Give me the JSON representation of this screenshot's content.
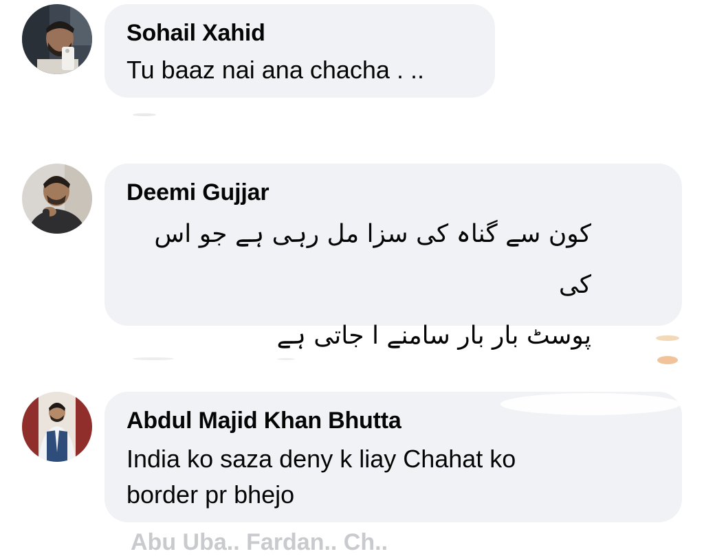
{
  "comments": [
    {
      "author": "Sohail Xahid",
      "text": "Tu baaz nai ana chacha . ..",
      "avatar": "avatar-man-selfie"
    },
    {
      "author": "Deemi Gujjar",
      "text_lines": [
        "کون سے گناہ کی سزا مل رہی ہے جو اس کی",
        "پوسٹ بار بار سامنے ا جاتی ہے"
      ],
      "avatar": "avatar-man-thinking"
    },
    {
      "author": "Abdul Majid Khan Bhutta",
      "text_lines": [
        "India ko saza deny k liay Chahat ko",
        "border pr bhejo"
      ],
      "avatar": "avatar-man-waistcoat"
    }
  ],
  "partially_visible_next_author": "Abu Uba.. Fardan.. Ch..",
  "colors": {
    "bubble": "#f0f2f5",
    "text": "#050505",
    "muted": "#8a8d91"
  }
}
